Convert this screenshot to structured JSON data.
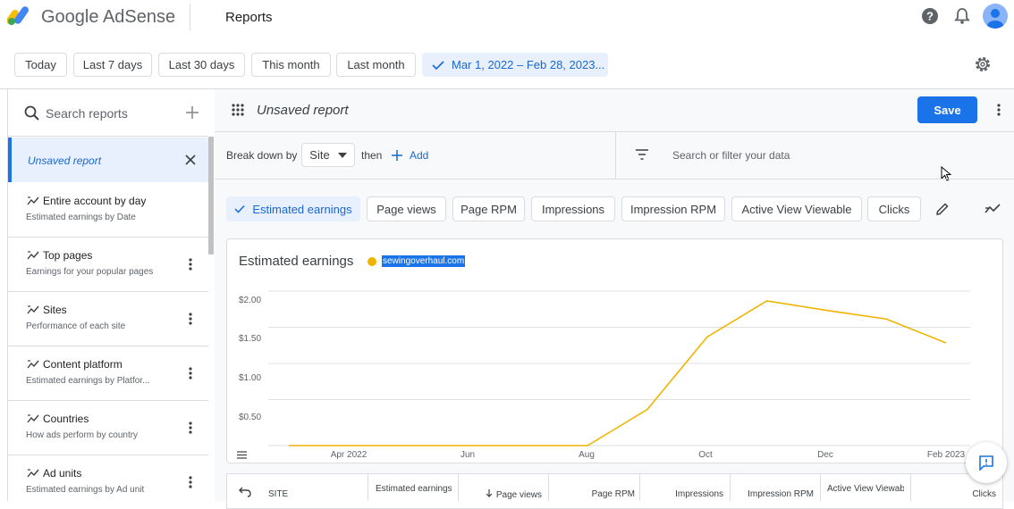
{
  "app": {
    "brand": "Google AdSense",
    "page_title": "Reports"
  },
  "date_filters": {
    "options": [
      "Today",
      "Last 7 days",
      "Last 30 days",
      "This month",
      "Last month"
    ],
    "selected_range": "Mar 1, 2022 – Feb 28, 2023..."
  },
  "sidebar": {
    "search_placeholder": "Search reports",
    "selected_item": "Unsaved report",
    "items": [
      {
        "title": "Entire account by day",
        "subtitle": "Estimated earnings by Date"
      },
      {
        "title": "Top pages",
        "subtitle": "Earnings for your popular pages"
      },
      {
        "title": "Sites",
        "subtitle": "Performance of each site"
      },
      {
        "title": "Content platform",
        "subtitle": "Estimated earnings by Platfor..."
      },
      {
        "title": "Countries",
        "subtitle": "How ads perform by country"
      },
      {
        "title": "Ad units",
        "subtitle": "Estimated earnings by Ad unit"
      }
    ]
  },
  "report": {
    "title": "Unsaved report",
    "save_label": "Save",
    "breakdown_label": "Break down by",
    "breakdown_value": "Site",
    "then_label": "then",
    "add_label": "Add",
    "filter_placeholder": "Search or filter your data"
  },
  "metrics": {
    "chips": [
      "Estimated earnings",
      "Page views",
      "Page RPM",
      "Impressions",
      "Impression RPM",
      "Active View Viewable",
      "Clicks"
    ],
    "selected": "Estimated earnings"
  },
  "chart_data": {
    "type": "line",
    "title": "Estimated earnings",
    "series": [
      {
        "name": "sewingoverhaul.com",
        "color": "#f0b400",
        "x": [
          "Mar 2022",
          "Apr 2022",
          "May 2022",
          "Jun 2022",
          "Jul 2022",
          "Aug 2022",
          "Sep 2022",
          "Oct 2022",
          "Nov 2022",
          "Dec 2022",
          "Jan 2023",
          "Feb 2023"
        ],
        "values": [
          0,
          0,
          0,
          0,
          0,
          0,
          0.5,
          1.5,
          2.0,
          1.87,
          1.75,
          1.42
        ]
      }
    ],
    "x_tick_labels": [
      "Apr 2022",
      "Jun",
      "Aug",
      "Oct",
      "Dec",
      "Feb 2023"
    ],
    "y_tick_labels": [
      "$2.00",
      "$1.50",
      "$1.00",
      "$0.50"
    ],
    "ylim": [
      0,
      2.0
    ],
    "grid": true,
    "legend": "top-left"
  },
  "table": {
    "columns": [
      "SITE",
      "Estimated earnings ($)",
      "Page views",
      "Page RPM",
      "Impressions",
      "Impression RPM",
      "Active View Viewable",
      "Clicks"
    ]
  },
  "colors": {
    "accent": "#1a73e8",
    "series": "#f0b400"
  }
}
